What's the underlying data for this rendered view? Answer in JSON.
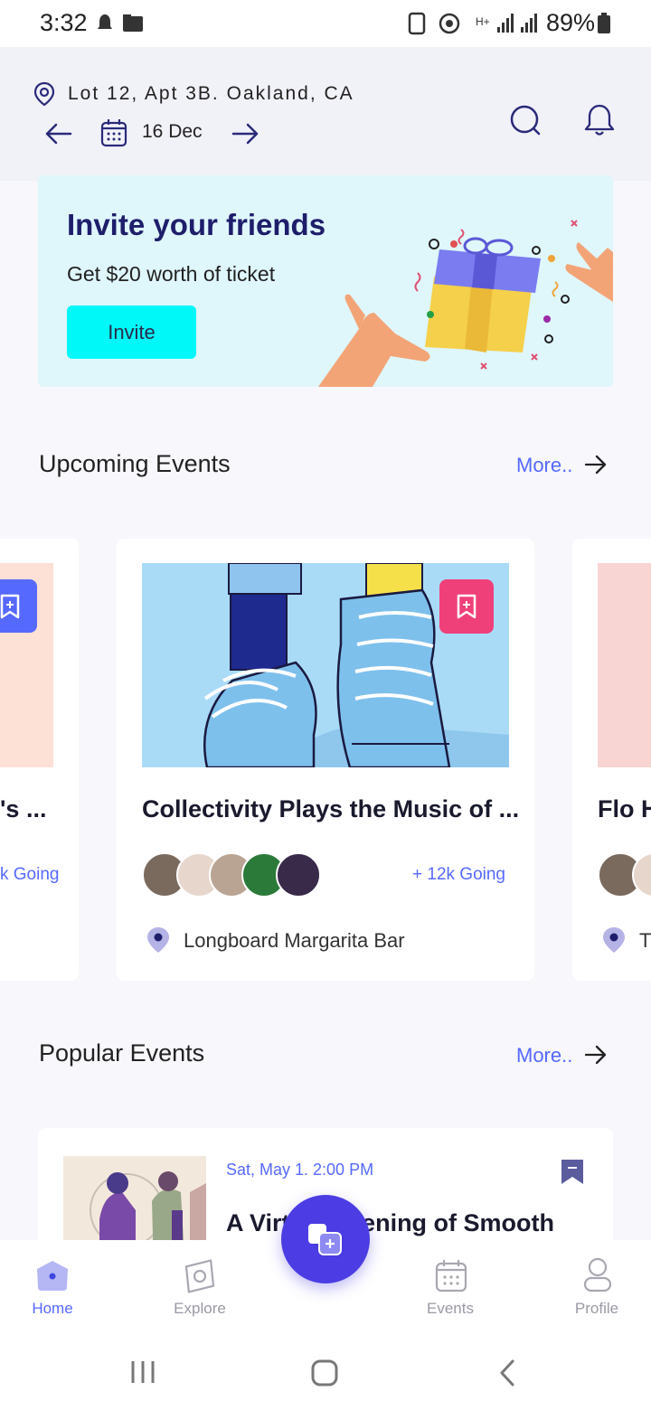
{
  "status_bar": {
    "time": "3:32",
    "battery": "89%"
  },
  "header": {
    "address": "Lot 12, Apt 3B. Oakland, CA",
    "date": "16 Dec"
  },
  "promo": {
    "title": "Invite your friends",
    "subtitle": "Get $20 worth of ticket",
    "button": "Invite"
  },
  "upcoming": {
    "title": "Upcoming Events",
    "more": "More..",
    "left_card": {
      "title_fragment": "'s ...",
      "going_fragment": "k Going"
    },
    "main_card": {
      "title": "Collectivity Plays the Music of ...",
      "going": "+ 12k Going",
      "venue": "Longboard Margarita Bar"
    },
    "right_card": {
      "title_fragment": "Flo H",
      "venue_fragment": "T"
    }
  },
  "popular": {
    "title": "Popular Events",
    "more": "More..",
    "event": {
      "date": "Sat, May 1. 2:00 PM",
      "title": "A Virtual Evening of Smooth"
    }
  },
  "nav": {
    "home": "Home",
    "explore": "Explore",
    "events": "Events",
    "profile": "Profile"
  },
  "colors": {
    "accent": "#5669ff",
    "fab": "#4b3de3",
    "promo_bg": "#dff6fb",
    "invite_btn": "#00f8f8",
    "bookmark_pink": "#f0407a",
    "bookmark_blue": "#5669ff"
  }
}
